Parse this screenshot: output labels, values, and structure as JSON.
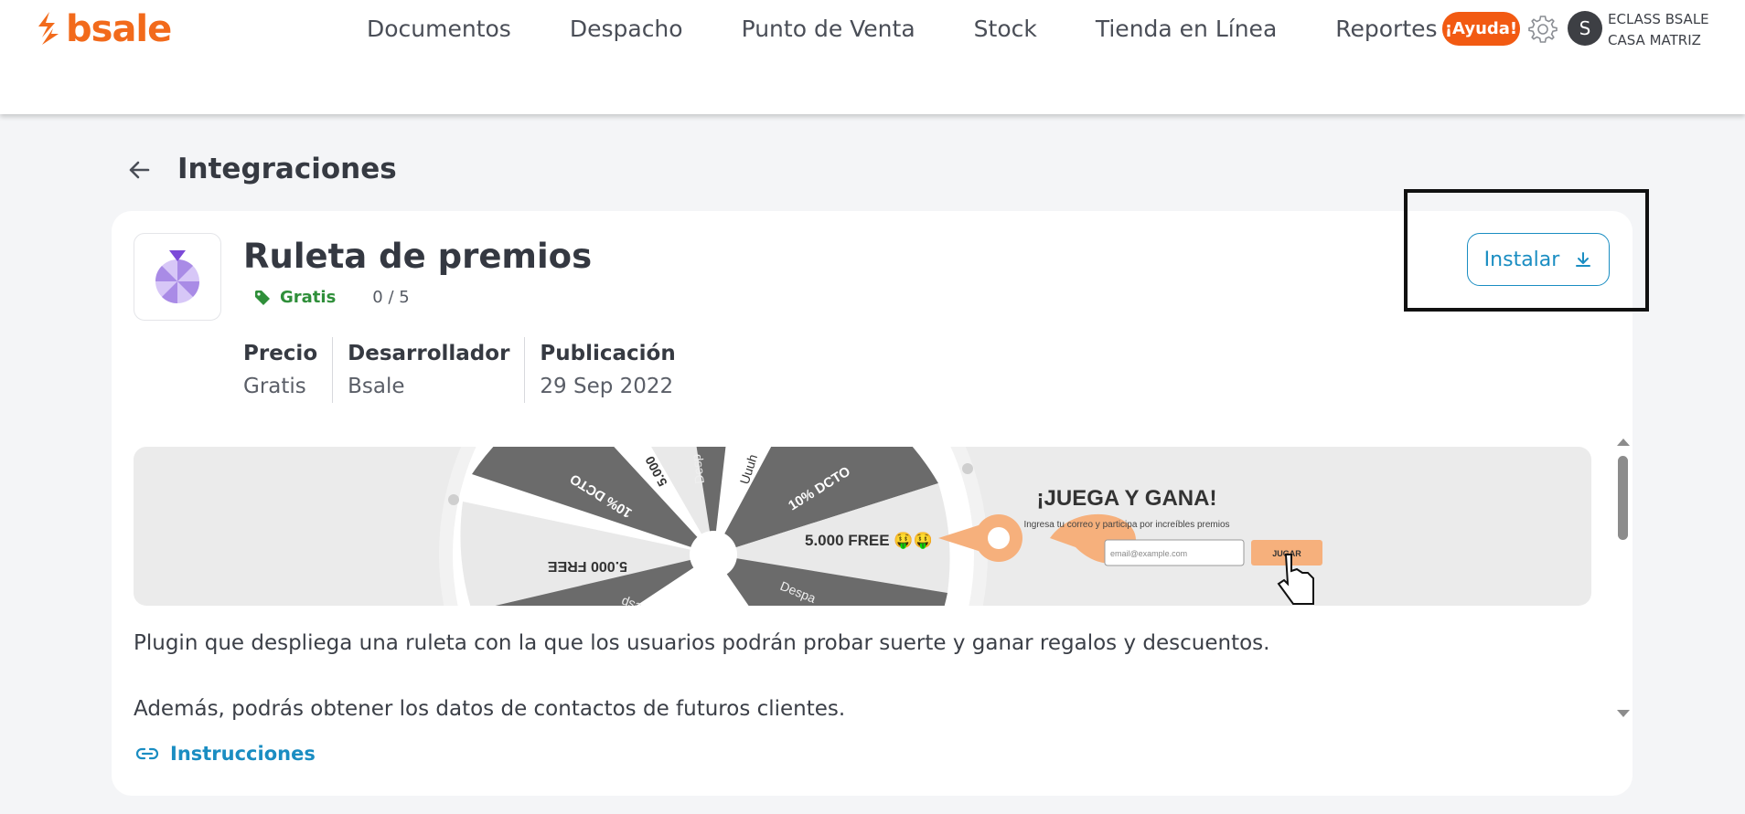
{
  "header": {
    "logo_text": "bsale",
    "nav": [
      "Documentos",
      "Despacho",
      "Punto de Venta",
      "Stock",
      "Tienda en Línea",
      "Reportes"
    ],
    "help_label": "¡Ayuda!",
    "avatar_initial": "S",
    "account_line1": "ECLASS BSALE",
    "account_line2": "CASA MATRIZ",
    "accent_color": "#f26a1b"
  },
  "page": {
    "title": "Integraciones"
  },
  "app": {
    "name": "Ruleta de premios",
    "tag": "Gratis",
    "rating": "0 / 5",
    "install_label": "Instalar",
    "meta": [
      {
        "label": "Precio",
        "value": "Gratis"
      },
      {
        "label": "Desarrollador",
        "value": "Bsale"
      },
      {
        "label": "Publicación",
        "value": "29 Sep 2022"
      }
    ],
    "banner": {
      "wheel_texts": [
        "5.000 FREE 🤑🤑",
        "10% DCTO",
        "5.000 FREE",
        "10% DCTO",
        "5.000",
        "Desp",
        "Uuuh",
        "Despa",
        "Desp"
      ],
      "heading": "¡JUEGA Y GANA!",
      "subtext": "Ingresa tu correo y participa por increíbles premios",
      "email_placeholder": "email@example.com",
      "play_label": "JUGAR"
    },
    "description_1": "Plugin que despliega una ruleta con la que los usuarios podrán probar suerte y ganar regalos y descuentos.",
    "description_2": "Además, podrás obtener los datos de contactos de futuros clientes.",
    "instructions_label": "Instrucciones"
  }
}
